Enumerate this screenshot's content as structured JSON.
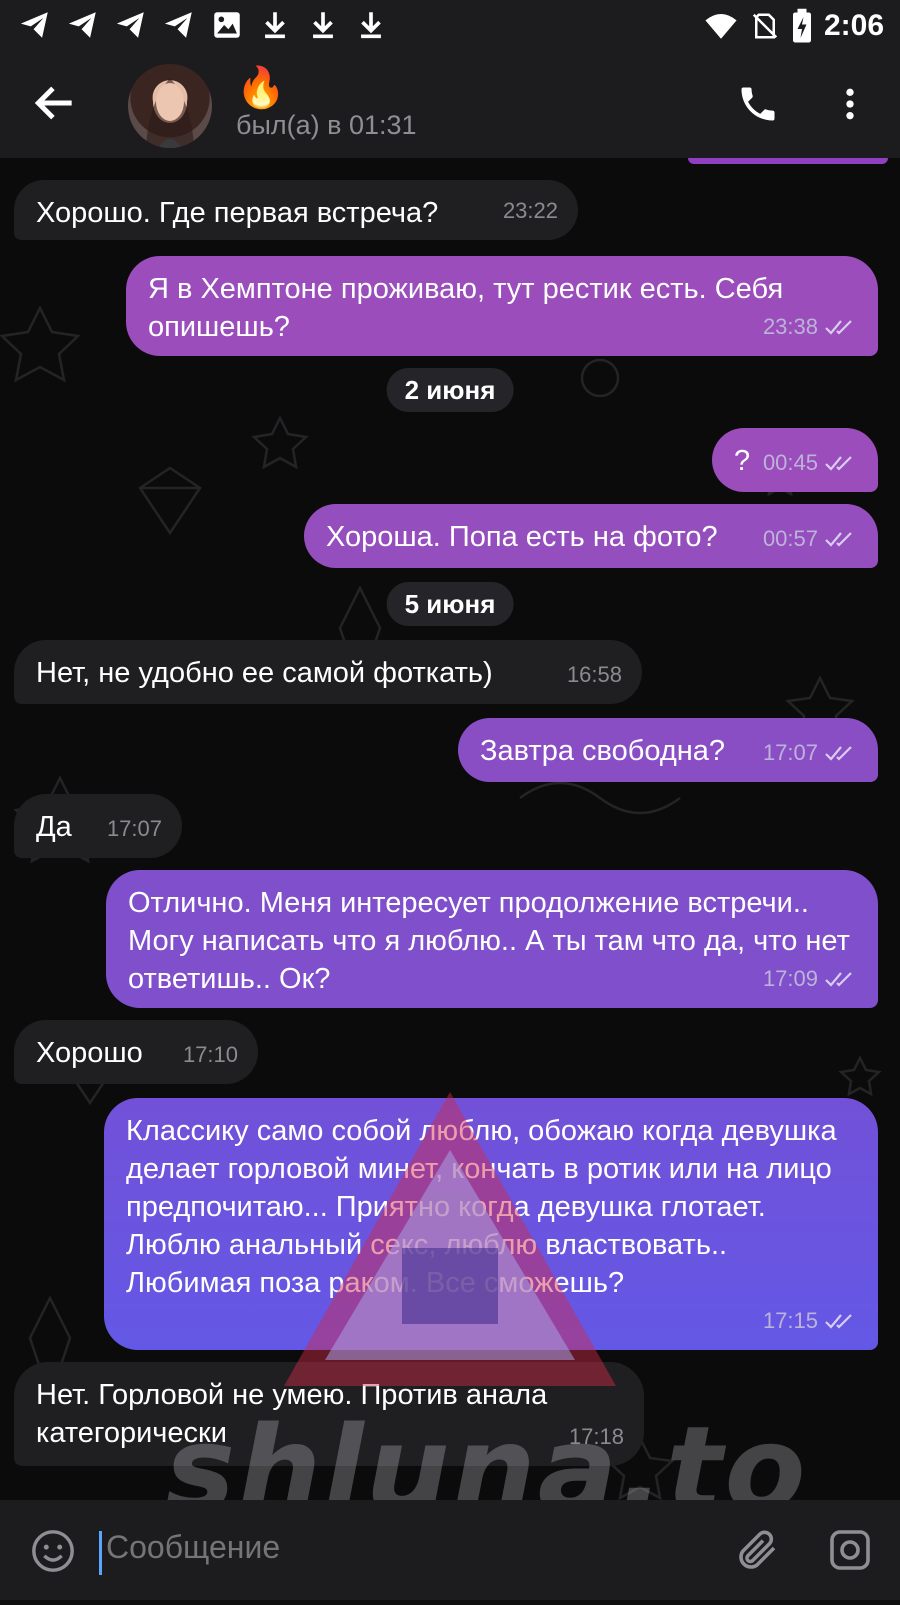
{
  "status_bar": {
    "time": "2:06",
    "notification_icons": [
      "telegram-icon",
      "telegram-icon",
      "telegram-icon",
      "telegram-icon",
      "image-icon",
      "download-icon",
      "download-icon",
      "download-icon"
    ],
    "system_icons": [
      "wifi-icon",
      "no-sim-icon",
      "battery-charging-icon"
    ]
  },
  "header": {
    "contact_name": "🔥",
    "last_seen": "был(а) в 01:31"
  },
  "chat": {
    "messages": [
      {
        "dir": "in",
        "text": "Хорошо. Где первая встреча?",
        "time": "23:22"
      },
      {
        "dir": "out",
        "text": "Я в Хемптоне проживаю, тут рестик есть. Себя опишешь?",
        "time": "23:38"
      },
      {
        "dir": "date",
        "text": "2 июня"
      },
      {
        "dir": "out",
        "text": "?",
        "time": "00:45"
      },
      {
        "dir": "out",
        "text": "Хороша. Попа есть на фото?",
        "time": "00:57"
      },
      {
        "dir": "date",
        "text": "5 июня"
      },
      {
        "dir": "in",
        "text": "Нет, не удобно ее самой фоткать)",
        "time": "16:58"
      },
      {
        "dir": "out",
        "text": "Завтра свободна?",
        "time": "17:07"
      },
      {
        "dir": "in",
        "text": "Да",
        "time": "17:07"
      },
      {
        "dir": "out",
        "text": "Отлично. Меня интересует продолжение встречи.. Могу написать что я люблю.. А ты там что да, что нет ответишь.. Ок?",
        "time": "17:09"
      },
      {
        "dir": "in",
        "text": "Хорошо",
        "time": "17:10"
      },
      {
        "dir": "out",
        "text": "Классику само собой люблю, обожаю когда девушка делает горловой минет, кончать в ротик или на лицо предпочитаю... Приятно когда девушка глотает. Люблю анальный секс, люблю властвовать.. Любимая поза раком. Все сможешь?",
        "time": "17:15"
      },
      {
        "dir": "in",
        "text": "Нет. Горловой не умею. Против анала категорически",
        "time": "17:18"
      }
    ]
  },
  "watermark": {
    "text": "shluna.to"
  },
  "composer": {
    "placeholder": "Сообщение"
  },
  "colors": {
    "outgoing_top": "#9a4dbb",
    "outgoing_bottom": "#6a5ae8",
    "incoming": "#1f1f22",
    "bars": "#1c1c1e"
  }
}
